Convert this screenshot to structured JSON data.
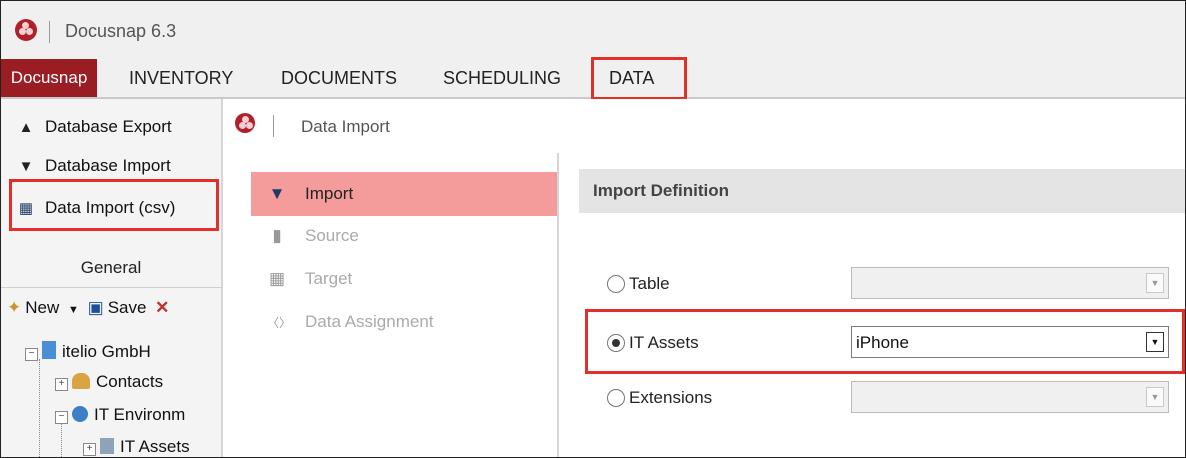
{
  "app": {
    "title": "Docusnap 6.3"
  },
  "ribbon": {
    "tabs": [
      "Docusnap",
      "INVENTORY",
      "DOCUMENTS",
      "SCHEDULING",
      "DATA"
    ],
    "active": "DATA"
  },
  "left_panel": {
    "actions": [
      {
        "label": "Database Export",
        "icon": "database-export-icon"
      },
      {
        "label": "Database Import",
        "icon": "database-import-icon"
      },
      {
        "label": "Data Import (csv)",
        "icon": "data-import-csv-icon"
      }
    ],
    "group_label": "General",
    "toolbar": {
      "new_label": "New",
      "save_label": "Save"
    },
    "tree": {
      "root": "itelio GmbH",
      "contacts": "Contacts",
      "it_environment": "IT Environm",
      "it_assets": "IT Assets"
    }
  },
  "dialog": {
    "title": "Data Import",
    "nav": [
      {
        "label": "Import",
        "icon": "import-icon",
        "active": true
      },
      {
        "label": "Source",
        "icon": "source-icon",
        "active": false
      },
      {
        "label": "Target",
        "icon": "target-icon",
        "active": false
      },
      {
        "label": "Data Assignment",
        "icon": "data-assignment-icon",
        "active": false
      }
    ],
    "section_title": "Import Definition",
    "options": {
      "table": {
        "label": "Table",
        "value": "",
        "selected": false
      },
      "it_assets": {
        "label": "IT Assets",
        "value": "iPhone",
        "selected": true
      },
      "extensions": {
        "label": "Extensions",
        "value": "",
        "selected": false
      }
    }
  },
  "colors": {
    "brand": "#9a1d24",
    "highlight": "#e0302a",
    "active_nav": "#f49c9c"
  }
}
